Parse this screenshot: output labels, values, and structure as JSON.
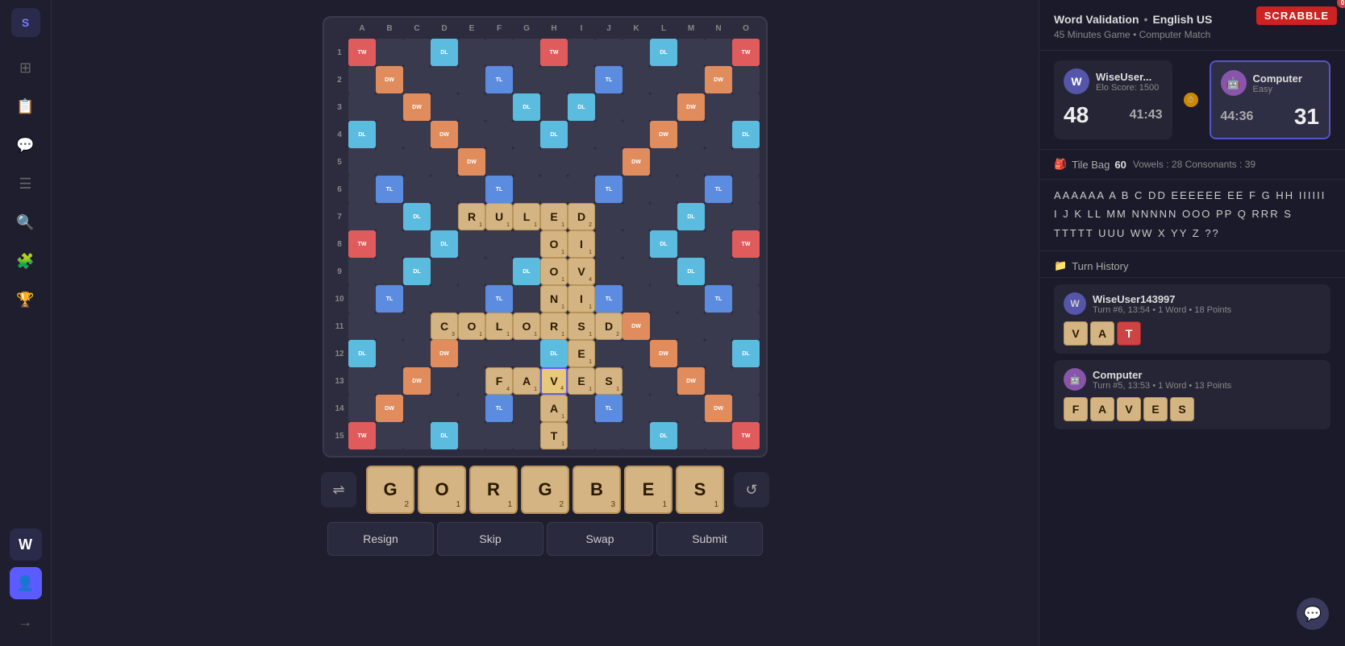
{
  "app": {
    "logo_label": "S",
    "scrabble_logo": "SCRABBLE"
  },
  "sidebar": {
    "items": [
      {
        "name": "home",
        "icon": "⊞",
        "active": false
      },
      {
        "name": "document",
        "icon": "📄",
        "active": false
      },
      {
        "name": "chat",
        "icon": "💬",
        "active": false
      },
      {
        "name": "list",
        "icon": "☰",
        "active": false
      },
      {
        "name": "search",
        "icon": "🔍",
        "active": false
      },
      {
        "name": "puzzle",
        "icon": "🧩",
        "active": false
      },
      {
        "name": "trophy",
        "icon": "🏆",
        "active": false
      },
      {
        "name": "word-w",
        "icon": "W",
        "active": true
      },
      {
        "name": "user",
        "icon": "👤",
        "active": true
      },
      {
        "name": "logout",
        "icon": "→",
        "active": false
      }
    ],
    "badge_count": "0"
  },
  "game": {
    "word_validation": "Word Validation",
    "language": "English US",
    "time": "45 Minutes Game",
    "match_type": "Computer Match",
    "player1": {
      "name": "WiseUser...",
      "elo": "Elo Score: 1500",
      "score": "48",
      "timer": "41:43",
      "avatar_letter": "W"
    },
    "player2": {
      "name": "Computer",
      "level": "Easy",
      "score": "31",
      "timer": "44:36",
      "avatar_emoji": "🤖"
    },
    "tile_bag": {
      "label": "Tile Bag",
      "count": "60",
      "vowels_label": "Vowels :",
      "vowels": "28",
      "consonants_label": "Consonants :",
      "consonants": "39"
    },
    "remaining_tiles": "AAAAAA  A  B  C  DD  EEEEEE\nEE  F  G  HH  IIIIII  I  J  K\nLL  MM  NNNNN  OOO  PP  Q\nRRR  S  TTTTT  UUU  WW  X\nYY  Z  ??",
    "turn_history_label": "Turn History",
    "turns": [
      {
        "player": "WiseUser143997",
        "avatar_letter": "W",
        "avatar_bg": "#5555aa",
        "details": "Turn #6, 13:54 • 1 Word • 18 Points",
        "tiles": [
          {
            "letter": "V",
            "color": "normal"
          },
          {
            "letter": "A",
            "color": "normal"
          },
          {
            "letter": "T",
            "color": "red"
          }
        ]
      },
      {
        "player": "Computer",
        "avatar_emoji": "🤖",
        "avatar_bg": "#8855aa",
        "details": "Turn #5, 13:53 • 1 Word • 13 Points",
        "tiles": [
          {
            "letter": "F",
            "color": "normal"
          },
          {
            "letter": "A",
            "color": "normal"
          },
          {
            "letter": "V",
            "color": "normal"
          },
          {
            "letter": "E",
            "color": "normal"
          },
          {
            "letter": "S",
            "color": "normal"
          }
        ]
      }
    ]
  },
  "board": {
    "cols": [
      "A",
      "B",
      "C",
      "D",
      "E",
      "F",
      "G",
      "H",
      "I",
      "J",
      "K",
      "L",
      "M",
      "N",
      "O"
    ],
    "rows": [
      "1",
      "2",
      "3",
      "4",
      "5",
      "6",
      "7",
      "8",
      "9",
      "10",
      "11",
      "12",
      "13",
      "14",
      "15"
    ],
    "special_cells": {
      "TW": [
        [
          0,
          0
        ],
        [
          0,
          7
        ],
        [
          0,
          14
        ],
        [
          7,
          0
        ],
        [
          7,
          14
        ],
        [
          14,
          0
        ],
        [
          14,
          7
        ],
        [
          14,
          14
        ]
      ],
      "DW": [
        [
          1,
          1
        ],
        [
          1,
          13
        ],
        [
          2,
          2
        ],
        [
          2,
          12
        ],
        [
          3,
          3
        ],
        [
          3,
          11
        ],
        [
          4,
          4
        ],
        [
          4,
          10
        ],
        [
          10,
          4
        ],
        [
          10,
          10
        ],
        [
          11,
          3
        ],
        [
          11,
          11
        ],
        [
          12,
          2
        ],
        [
          12,
          12
        ],
        [
          13,
          1
        ],
        [
          13,
          13
        ]
      ],
      "TL": [
        [
          1,
          5
        ],
        [
          1,
          9
        ],
        [
          5,
          1
        ],
        [
          5,
          5
        ],
        [
          5,
          9
        ],
        [
          5,
          13
        ],
        [
          9,
          1
        ],
        [
          9,
          5
        ],
        [
          9,
          9
        ],
        [
          9,
          13
        ],
        [
          13,
          5
        ],
        [
          13,
          9
        ]
      ],
      "DL": [
        [
          0,
          3
        ],
        [
          0,
          11
        ],
        [
          2,
          6
        ],
        [
          2,
          8
        ],
        [
          3,
          0
        ],
        [
          3,
          7
        ],
        [
          3,
          14
        ],
        [
          6,
          2
        ],
        [
          6,
          6
        ],
        [
          6,
          8
        ],
        [
          6,
          12
        ],
        [
          7,
          3
        ],
        [
          7,
          11
        ],
        [
          8,
          2
        ],
        [
          8,
          6
        ],
        [
          8,
          8
        ],
        [
          8,
          12
        ],
        [
          11,
          0
        ],
        [
          11,
          7
        ],
        [
          11,
          14
        ],
        [
          12,
          6
        ],
        [
          12,
          8
        ],
        [
          14,
          3
        ],
        [
          14,
          11
        ]
      ]
    }
  },
  "placed_tiles": [
    {
      "row": 6,
      "col": 4,
      "letter": "R",
      "value": "1"
    },
    {
      "row": 6,
      "col": 5,
      "letter": "U",
      "value": "1"
    },
    {
      "row": 6,
      "col": 6,
      "letter": "L",
      "value": "1"
    },
    {
      "row": 6,
      "col": 7,
      "letter": "E",
      "value": "1"
    },
    {
      "row": 6,
      "col": 8,
      "letter": "D",
      "value": "2"
    },
    {
      "row": 7,
      "col": 7,
      "letter": "O",
      "value": "1"
    },
    {
      "row": 7,
      "col": 8,
      "letter": "I",
      "value": "1"
    },
    {
      "row": 8,
      "col": 7,
      "letter": "O",
      "value": "1"
    },
    {
      "row": 8,
      "col": 8,
      "letter": "V",
      "value": "4"
    },
    {
      "row": 9,
      "col": 7,
      "letter": "N",
      "value": "1"
    },
    {
      "row": 9,
      "col": 8,
      "letter": "I",
      "value": "1"
    },
    {
      "row": 10,
      "col": 3,
      "letter": "C",
      "value": "3"
    },
    {
      "row": 10,
      "col": 4,
      "letter": "O",
      "value": "1"
    },
    {
      "row": 10,
      "col": 5,
      "letter": "L",
      "value": "1"
    },
    {
      "row": 10,
      "col": 6,
      "letter": "O",
      "value": "1"
    },
    {
      "row": 10,
      "col": 7,
      "letter": "R",
      "value": "1"
    },
    {
      "row": 10,
      "col": 8,
      "letter": "S",
      "value": "1"
    },
    {
      "row": 10,
      "col": 9,
      "letter": "D",
      "value": "2"
    },
    {
      "row": 11,
      "col": 8,
      "letter": "E",
      "value": "1"
    },
    {
      "row": 12,
      "col": 5,
      "letter": "F",
      "value": "4"
    },
    {
      "row": 12,
      "col": 6,
      "letter": "A",
      "value": "1"
    },
    {
      "row": 12,
      "col": 7,
      "letter": "V",
      "value": "4"
    },
    {
      "row": 12,
      "col": 8,
      "letter": "E",
      "value": "1"
    },
    {
      "row": 12,
      "col": 9,
      "letter": "S",
      "value": "1"
    },
    {
      "row": 13,
      "col": 7,
      "letter": "A",
      "value": "1"
    },
    {
      "row": 14,
      "col": 7,
      "letter": "T",
      "value": "1"
    }
  ],
  "selected_tile": {
    "row": 12,
    "col": 7
  },
  "rack": {
    "tiles": [
      {
        "letter": "G",
        "value": "2"
      },
      {
        "letter": "O",
        "value": "1"
      },
      {
        "letter": "R",
        "value": "1"
      },
      {
        "letter": "G",
        "value": "2"
      },
      {
        "letter": "B",
        "value": "3"
      },
      {
        "letter": "E",
        "value": "1"
      },
      {
        "letter": "S",
        "value": "1"
      }
    ]
  },
  "actions": {
    "resign": "Resign",
    "skip": "Skip",
    "swap": "Swap",
    "submit": "Submit"
  }
}
